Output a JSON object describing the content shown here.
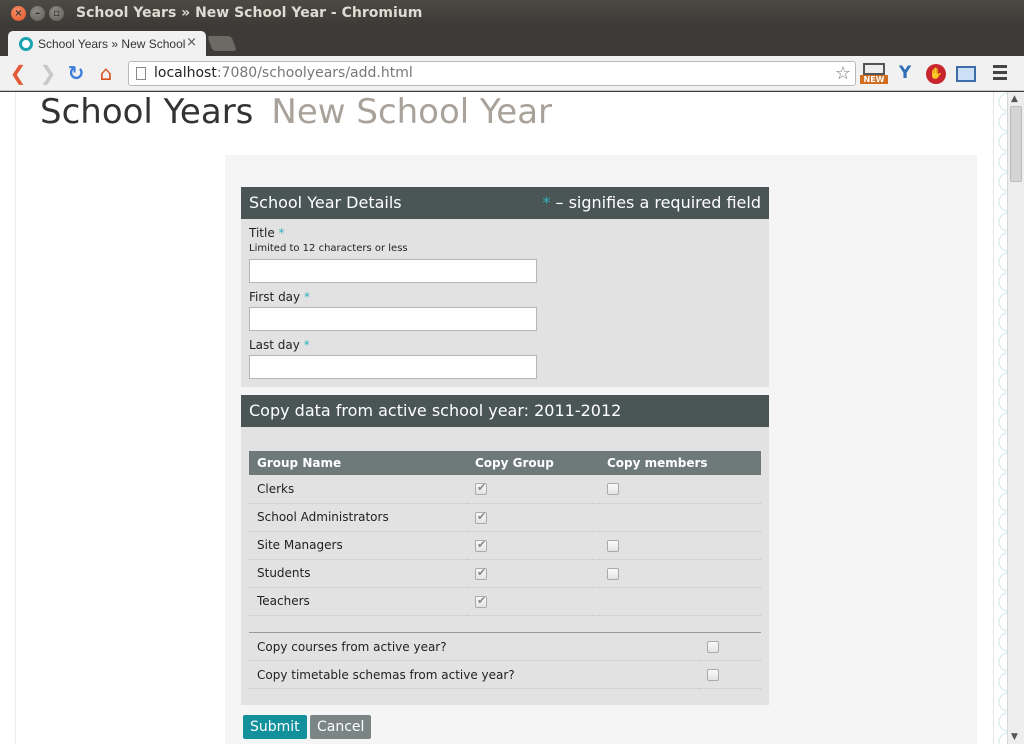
{
  "window": {
    "title": "School Years » New School Year - Chromium"
  },
  "tab": {
    "title": "School Years » New School Year",
    "close": "×"
  },
  "toolbar": {
    "url_host": "localhost",
    "url_rest": ":7080/schoolyears/add.html",
    "ext_new_label": "NEW",
    "ext_y_label": "Y",
    "ext_stop_label": "✋"
  },
  "page": {
    "heading": "School Years",
    "subheading": "New School Year"
  },
  "details_panel": {
    "title": "School Year Details",
    "required_star": "*",
    "required_note": " – signifies a required field",
    "fields": [
      {
        "label": "Title",
        "star": "*",
        "hint": "Limited to 12 characters or less",
        "value": ""
      },
      {
        "label": "First day",
        "star": "*",
        "value": ""
      },
      {
        "label": "Last day",
        "star": "*",
        "value": ""
      }
    ]
  },
  "copy_panel": {
    "title": "Copy data from active school year: 2011-2012",
    "columns": [
      "Group Name",
      "Copy Group",
      "Copy members"
    ],
    "rows": [
      {
        "name": "Clerks",
        "copy_group": true,
        "has_members": true,
        "copy_members": false
      },
      {
        "name": "School Administrators",
        "copy_group": true,
        "has_members": false,
        "copy_members": false
      },
      {
        "name": "Site Managers",
        "copy_group": true,
        "has_members": true,
        "copy_members": false
      },
      {
        "name": "Students",
        "copy_group": true,
        "has_members": true,
        "copy_members": false
      },
      {
        "name": "Teachers",
        "copy_group": true,
        "has_members": false,
        "copy_members": false
      }
    ],
    "options": [
      {
        "label": "Copy courses from active year?",
        "checked": false
      },
      {
        "label": "Copy timetable schemas from active year?",
        "checked": false
      }
    ]
  },
  "buttons": {
    "submit": "Submit",
    "cancel": "Cancel"
  }
}
